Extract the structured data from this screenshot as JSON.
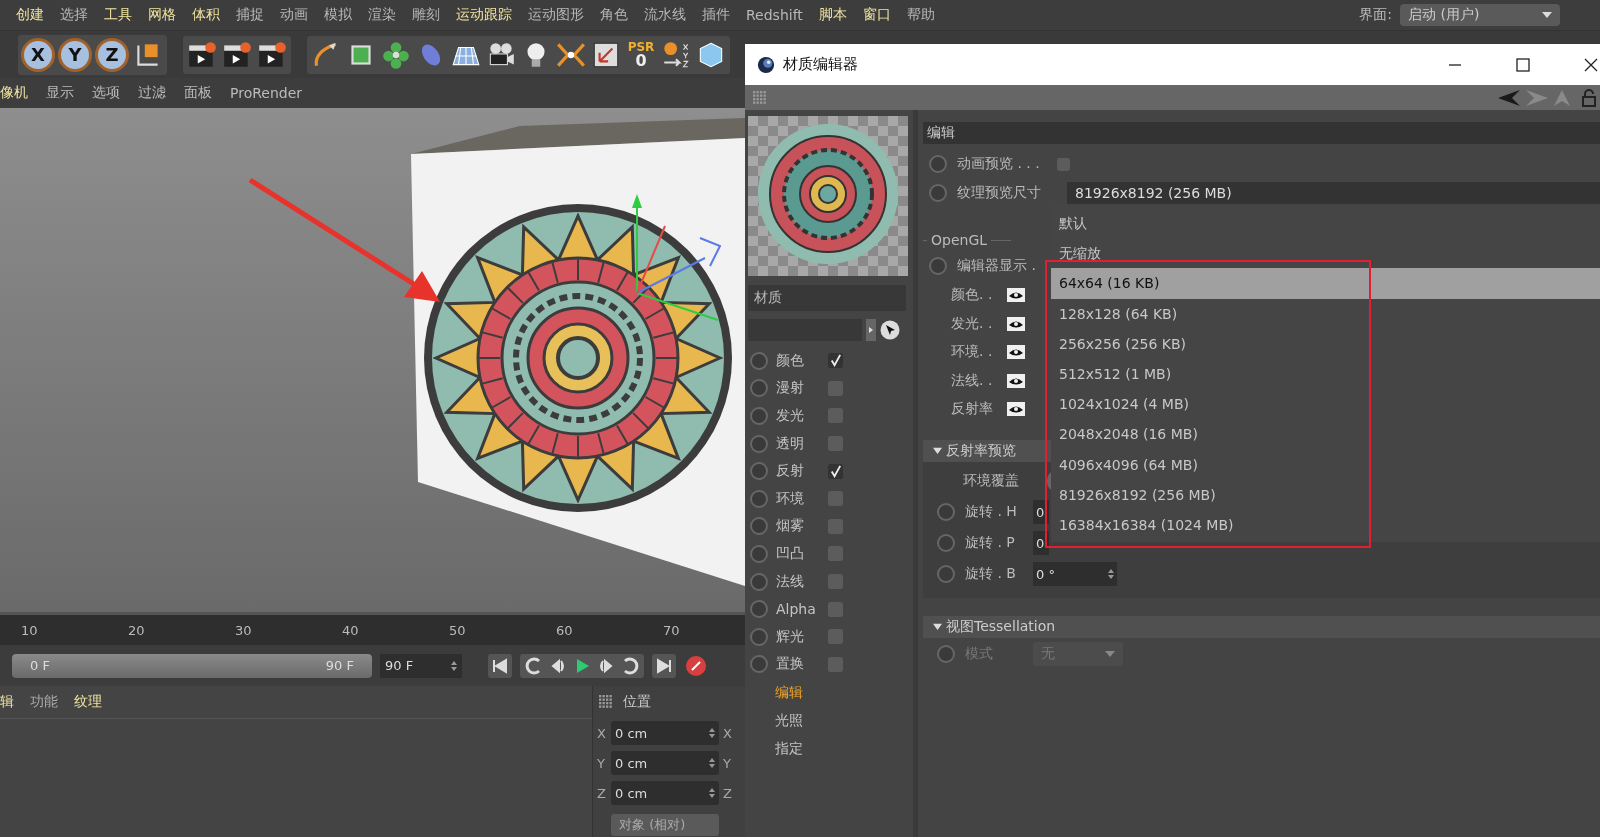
{
  "menubar": {
    "items": [
      {
        "label": "创建",
        "highlight": true
      },
      {
        "label": "选择",
        "highlight": false
      },
      {
        "label": "工具",
        "highlight": true
      },
      {
        "label": "网格",
        "highlight": true
      },
      {
        "label": "体积",
        "highlight": true
      },
      {
        "label": "捕捉",
        "highlight": false
      },
      {
        "label": "动画",
        "highlight": false
      },
      {
        "label": "模拟",
        "highlight": false
      },
      {
        "label": "渲染",
        "highlight": false
      },
      {
        "label": "雕刻",
        "highlight": false
      },
      {
        "label": "运动跟踪",
        "highlight": true
      },
      {
        "label": "运动图形",
        "highlight": false
      },
      {
        "label": "角色",
        "highlight": false
      },
      {
        "label": "流水线",
        "highlight": false
      },
      {
        "label": "插件",
        "highlight": false
      },
      {
        "label": "Redshift",
        "highlight": false
      },
      {
        "label": "脚本",
        "highlight": true
      },
      {
        "label": "窗口",
        "highlight": true
      },
      {
        "label": "帮助",
        "highlight": false
      }
    ],
    "interface": {
      "label": "界面:",
      "value": "启动 (用户)"
    }
  },
  "toolbar": {
    "axis_buttons": [
      "X",
      "Y",
      "Z"
    ],
    "psr": {
      "label": "PSR",
      "value": "0"
    }
  },
  "viewport_menu": {
    "items": [
      {
        "label": "像机",
        "highlight": true
      },
      {
        "label": "显示",
        "highlight": false
      },
      {
        "label": "选项",
        "highlight": false
      },
      {
        "label": "过滤",
        "highlight": false
      },
      {
        "label": "面板",
        "highlight": false
      },
      {
        "label": "ProRender",
        "highlight": false
      }
    ]
  },
  "timeline": {
    "level": 1,
    "ticks": [
      "10",
      "20",
      "30",
      "40",
      "50",
      "60",
      "70"
    ],
    "range_start": "0 F",
    "range_end": "90 F",
    "end_field": "90 F"
  },
  "bottom_tabs": [
    {
      "label": "辑",
      "highlight": true
    },
    {
      "label": "功能",
      "highlight": false
    },
    {
      "label": "纹理",
      "highlight": true
    }
  ],
  "position": {
    "title": "位置",
    "rows": [
      {
        "axis": "X",
        "value": "0 cm",
        "axis_2": "X"
      },
      {
        "axis": "Y",
        "value": "0 cm",
        "axis_2": "Y"
      },
      {
        "axis": "Z",
        "value": "0 cm",
        "axis_2": "Z"
      }
    ],
    "mode": "对象 (相对)"
  },
  "material_editor": {
    "title": "材质编辑器",
    "material_name": "材质",
    "channels": [
      {
        "label": "颜色",
        "checked": true
      },
      {
        "label": "漫射",
        "checked": false
      },
      {
        "label": "发光",
        "checked": false
      },
      {
        "label": "透明",
        "checked": false
      },
      {
        "label": "反射",
        "checked": true
      },
      {
        "label": "环境",
        "checked": false
      },
      {
        "label": "烟雾",
        "checked": false
      },
      {
        "label": "凹凸",
        "checked": false
      },
      {
        "label": "法线",
        "checked": false
      },
      {
        "label": "Alpha",
        "checked": false
      },
      {
        "label": "辉光",
        "checked": false
      },
      {
        "label": "置换",
        "checked": false
      }
    ],
    "pages": [
      {
        "label": "编辑",
        "selected": true
      },
      {
        "label": "光照",
        "selected": false
      },
      {
        "label": "指定",
        "selected": false
      }
    ],
    "panel": {
      "title": "编辑",
      "anim_preview": {
        "label": "动画预览 . . .",
        "checked": false
      },
      "texture_size": {
        "label": "纹理预览尺寸",
        "value": "81926x8192 (256 MB)"
      },
      "opengl_group": "OpenGL",
      "editor_display": "编辑器显示 .",
      "eye_rows": [
        "颜色. .",
        "发光. .",
        "环境. .",
        "法线. .",
        "反射率"
      ],
      "reflectance": {
        "title": "反射率预览",
        "expanded": true,
        "env_override": "环境覆盖",
        "rotations": [
          {
            "label": "旋转 . H",
            "value": "0"
          },
          {
            "label": "旋转 . P",
            "value": "0"
          },
          {
            "label": "旋转 . B",
            "value": "0 °"
          }
        ]
      },
      "tessellation": {
        "title": "视图Tessellation",
        "expanded": true,
        "mode_label": "模式",
        "mode_value": "无",
        "disabled": true
      }
    },
    "dropdown_menu": [
      {
        "label": "默认",
        "selected": false
      },
      {
        "label": "无缩放",
        "selected": false
      },
      {
        "label": "64x64 (16 KB)",
        "selected": true
      },
      {
        "label": "128x128 (64 KB)",
        "selected": false
      },
      {
        "label": "256x256 (256 KB)",
        "selected": false
      },
      {
        "label": "512x512 (1 MB)",
        "selected": false
      },
      {
        "label": "1024x1024 (4 MB)",
        "selected": false
      },
      {
        "label": "2048x2048 (16 MB)",
        "selected": false
      },
      {
        "label": "4096x4096 (64 MB)",
        "selected": false
      },
      {
        "label": "81926x8192 (256 MB)",
        "selected": false
      },
      {
        "label": "16384x16384 (1024 MB)",
        "selected": false
      }
    ]
  }
}
